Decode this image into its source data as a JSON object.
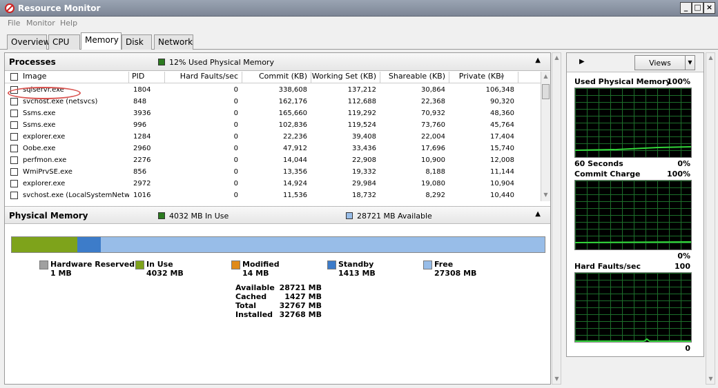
{
  "window": {
    "title": "Resource Monitor"
  },
  "menu": [
    "File",
    "Monitor",
    "Help"
  ],
  "tabs": [
    "Overview",
    "CPU",
    "Memory",
    "Disk",
    "Network"
  ],
  "processes": {
    "title": "Processes",
    "summary": "12% Used Physical Memory",
    "columns": [
      "Image",
      "PID",
      "Hard Faults/sec",
      "Commit (KB)",
      "Working Set (KB)",
      "Shareable (KB)",
      "Private (KB)"
    ],
    "rows": [
      {
        "image": "sqlservr.exe",
        "pid": "1804",
        "hard_faults": "0",
        "commit": "338,608",
        "working_set": "137,212",
        "shareable": "30,864",
        "private": "106,348"
      },
      {
        "image": "svchost.exe (netsvcs)",
        "pid": "848",
        "hard_faults": "0",
        "commit": "162,176",
        "working_set": "112,688",
        "shareable": "22,368",
        "private": "90,320"
      },
      {
        "image": "Ssms.exe",
        "pid": "3936",
        "hard_faults": "0",
        "commit": "165,660",
        "working_set": "119,292",
        "shareable": "70,932",
        "private": "48,360"
      },
      {
        "image": "Ssms.exe",
        "pid": "996",
        "hard_faults": "0",
        "commit": "102,836",
        "working_set": "119,524",
        "shareable": "73,760",
        "private": "45,764"
      },
      {
        "image": "explorer.exe",
        "pid": "1284",
        "hard_faults": "0",
        "commit": "22,236",
        "working_set": "39,408",
        "shareable": "22,004",
        "private": "17,404"
      },
      {
        "image": "Oobe.exe",
        "pid": "2960",
        "hard_faults": "0",
        "commit": "47,912",
        "working_set": "33,436",
        "shareable": "17,696",
        "private": "15,740"
      },
      {
        "image": "perfmon.exe",
        "pid": "2276",
        "hard_faults": "0",
        "commit": "14,044",
        "working_set": "22,908",
        "shareable": "10,900",
        "private": "12,008"
      },
      {
        "image": "WmiPrvSE.exe",
        "pid": "856",
        "hard_faults": "0",
        "commit": "13,356",
        "working_set": "19,332",
        "shareable": "8,188",
        "private": "11,144"
      },
      {
        "image": "explorer.exe",
        "pid": "2972",
        "hard_faults": "0",
        "commit": "14,924",
        "working_set": "29,984",
        "shareable": "19,080",
        "private": "10,904"
      },
      {
        "image": "svchost.exe (LocalSystemNetwo...",
        "pid": "1016",
        "hard_faults": "0",
        "commit": "11,536",
        "working_set": "18,732",
        "shareable": "8,292",
        "private": "10,440"
      }
    ]
  },
  "physical_memory": {
    "title": "Physical Memory",
    "in_use": "4032 MB In Use",
    "available": "28721 MB Available",
    "bar": {
      "hardware_reserved_mb": 1,
      "in_use_mb": 4032,
      "modified_mb": 14,
      "standby_mb": 1413,
      "free_mb": 27308
    },
    "legend": [
      {
        "name": "Hardware Reserved",
        "value": "1 MB",
        "color": "#a0a0a0"
      },
      {
        "name": "In Use",
        "value": "4032 MB",
        "color": "#7ea31b"
      },
      {
        "name": "Modified",
        "value": "14 MB",
        "color": "#e08a1a"
      },
      {
        "name": "Standby",
        "value": "1413 MB",
        "color": "#3d7cc9"
      },
      {
        "name": "Free",
        "value": "27308 MB",
        "color": "#98bde8"
      }
    ],
    "summary": [
      {
        "label": "Available",
        "value": "28721 MB"
      },
      {
        "label": "Cached",
        "value": "1427 MB"
      },
      {
        "label": "Total",
        "value": "32767 MB"
      },
      {
        "label": "Installed",
        "value": "32768 MB"
      }
    ]
  },
  "graphs": {
    "views_label": "Views",
    "items": [
      {
        "title": "Used Physical Memory",
        "max": "100%",
        "footer": "60 Seconds",
        "min": "0%",
        "level": 0.12
      },
      {
        "title": "Commit Charge",
        "max": "100%",
        "footer": "",
        "min": "0%",
        "level": 0.1
      },
      {
        "title": "Hard Faults/sec",
        "max": "100",
        "footer": "",
        "min": "0",
        "level": 0.0
      }
    ]
  }
}
